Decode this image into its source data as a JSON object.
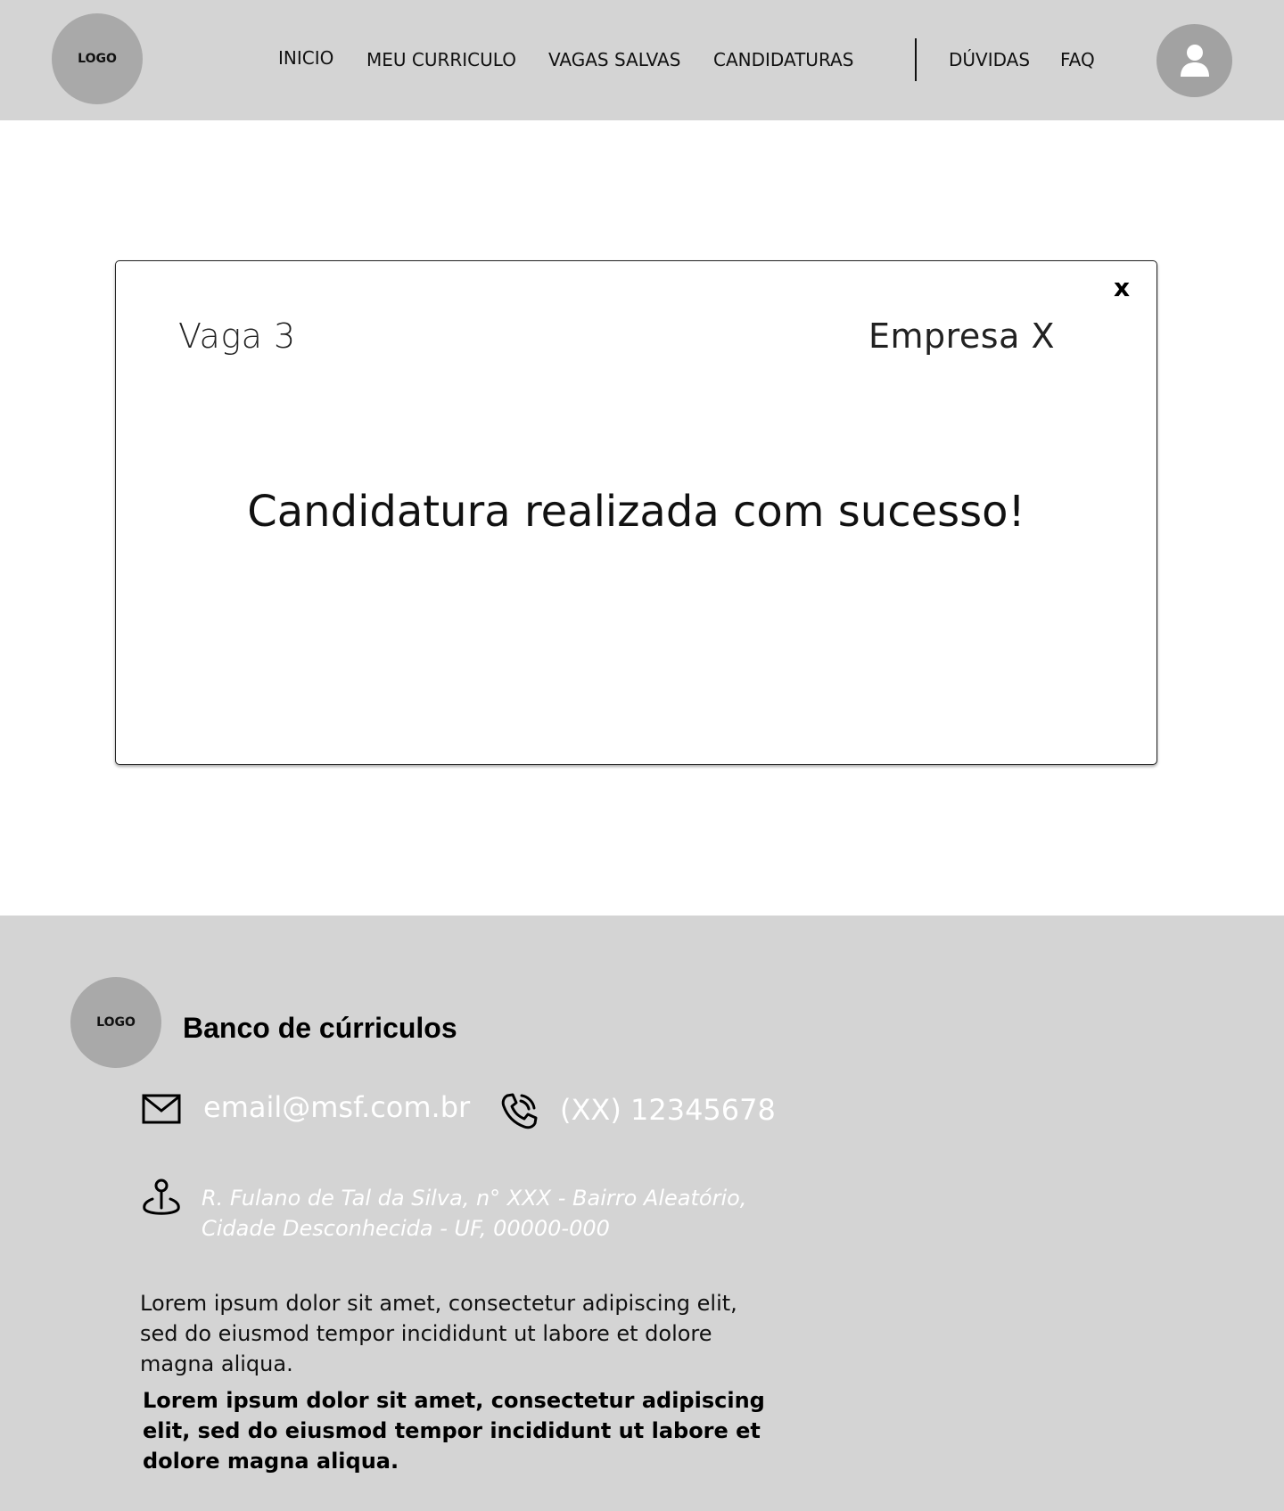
{
  "header": {
    "logo_text": "LOGO",
    "nav": [
      {
        "label": "INICIO"
      },
      {
        "label": "MEU CURRICULO"
      },
      {
        "label": "VAGAS SALVAS"
      },
      {
        "label": "CANDIDATURAS"
      },
      {
        "label": "DÚVIDAS"
      },
      {
        "label": "FAQ"
      }
    ],
    "avatar_icon": "user-icon"
  },
  "modal": {
    "close_label": "x",
    "job_title": "Vaga 3",
    "company": "Empresa X",
    "message": "Candidatura realizada com sucesso!"
  },
  "footer": {
    "logo_text": "LOGO",
    "brand": "Banco de cúrriculos",
    "email_icon": "mail-icon",
    "email": "email@msf.com.br",
    "phone_icon": "phone-icon",
    "phone": "(XX) 12345678",
    "address_icon": "location-pin-icon",
    "address_line1": "R. Fulano de Tal da Silva, n° XXX - Bairro Aleatório,",
    "address_line2": "Cidade Desconhecida - UF, 00000-000",
    "text": "Lorem ipsum dolor sit amet, consectetur adipiscing elit, sed do eiusmod tempor incididunt ut labore et dolore magna aliqua.",
    "text_bold": "Lorem ipsum dolor sit amet, consectetur adipiscing elit, sed do eiusmod tempor incididunt ut labore et dolore magna aliqua."
  },
  "colors": {
    "header_bg": "#d4d4d4",
    "footer_bg": "#d4d4d4",
    "logo_circle": "#a9a9a9",
    "avatar_bg": "#a2a2a2",
    "footer_contact_text": "#ffffff"
  }
}
